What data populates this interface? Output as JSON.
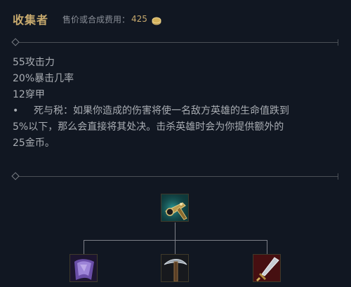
{
  "item": {
    "name": "收集者",
    "price_label": "售价或合成费用：",
    "price_value": "425",
    "currency_icon": "gold-coin-icon"
  },
  "stats": [
    "55攻击力",
    "20%暴击几率",
    "12穿甲"
  ],
  "passive": {
    "bullet": "•",
    "line1": "死与税：如果你造成的伤害将使一名敌方英雄的生命值跌到",
    "line2": "5%以下，那么会直接将其处决。击杀英雄时会为你提供额外的",
    "line3": "25金币。"
  },
  "recipe": {
    "root_icon": "the-collector-icon",
    "components": [
      "cloak-of-agility-icon",
      "serrated-dirk-pickaxe-icon",
      "long-sword-icon"
    ]
  },
  "colors": {
    "gold": "#c8aa6e",
    "text": "#a9adb3",
    "muted": "#8a8f98",
    "background": "#111722"
  }
}
